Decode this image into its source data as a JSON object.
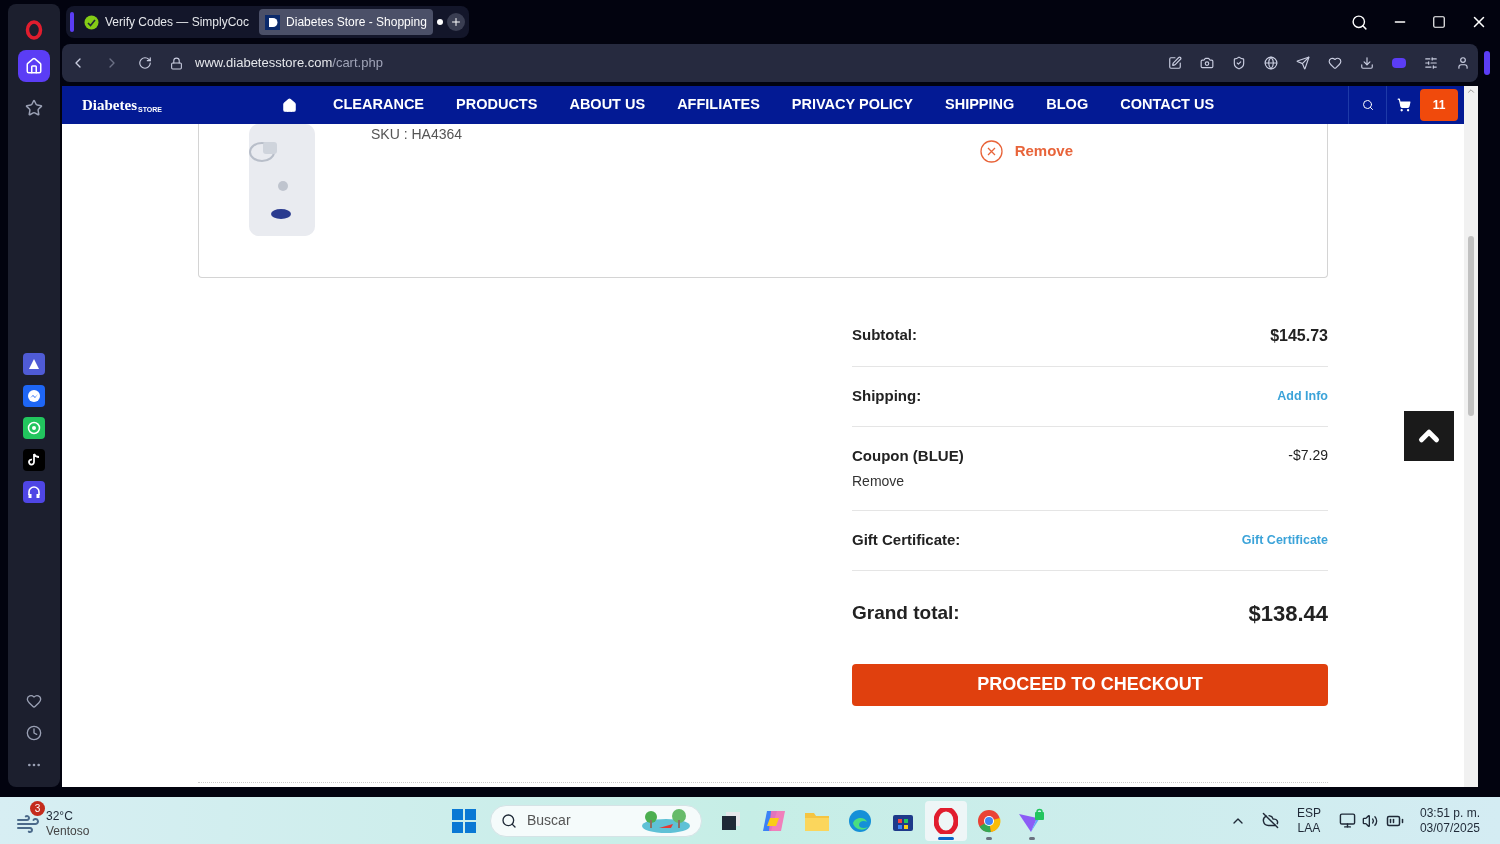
{
  "browser": {
    "tabs": [
      {
        "title": "Verify Codes — SimplyCoc",
        "selected": false
      },
      {
        "title": "Diabetes Store - Shopping",
        "selected": true
      }
    ],
    "address": {
      "host": "www.diabetesstore.com",
      "path": "/cart.php"
    },
    "sidebar": [
      {
        "kind": "home",
        "selected": true
      },
      {
        "kind": "star",
        "selected": false
      }
    ]
  },
  "site": {
    "logo": {
      "name": "Diabetes",
      "sub": "STORE"
    },
    "nav": [
      "CLEARANCE",
      "PRODUCTS",
      "ABOUT US",
      "AFFILIATES",
      "PRIVACY POLICY",
      "SHIPPING",
      "BLOG",
      "CONTACT US"
    ],
    "cart_count": "11"
  },
  "cart_item": {
    "sku_label": "SKU :",
    "sku": "HA4364",
    "remove": "Remove"
  },
  "summary": {
    "rows": [
      {
        "kind": "amount",
        "label": "Subtotal:",
        "value": "$145.73"
      },
      {
        "kind": "link",
        "label": "Shipping:",
        "value": "Add Info"
      },
      {
        "kind": "coupon",
        "label": "Coupon (BLUE)",
        "sub": "Remove",
        "value": "-$7.29"
      },
      {
        "kind": "link",
        "label": "Gift Certificate:",
        "value": "Gift Certificate"
      }
    ],
    "grand_label": "Grand total:",
    "grand_value": "$138.44",
    "checkout": "PROCEED TO CHECKOUT"
  },
  "taskbar": {
    "weather": {
      "badge": "3",
      "temp": "32°C",
      "condition": "Ventoso"
    },
    "search_placeholder": "Buscar",
    "apps": [
      {
        "kind": "taskview",
        "selected": false,
        "running": false
      },
      {
        "kind": "copilot",
        "selected": false,
        "running": false
      },
      {
        "kind": "files",
        "selected": false,
        "running": false
      },
      {
        "kind": "edge",
        "selected": false,
        "running": false
      },
      {
        "kind": "store",
        "selected": false,
        "running": false
      },
      {
        "kind": "opera",
        "selected": true,
        "running": true
      },
      {
        "kind": "chrome",
        "selected": false,
        "running": true
      },
      {
        "kind": "vpn",
        "selected": false,
        "running": true
      }
    ],
    "lang": "ESP",
    "layout": "LAA",
    "time": "03:51 p. m.",
    "date": "03/07/2025"
  }
}
